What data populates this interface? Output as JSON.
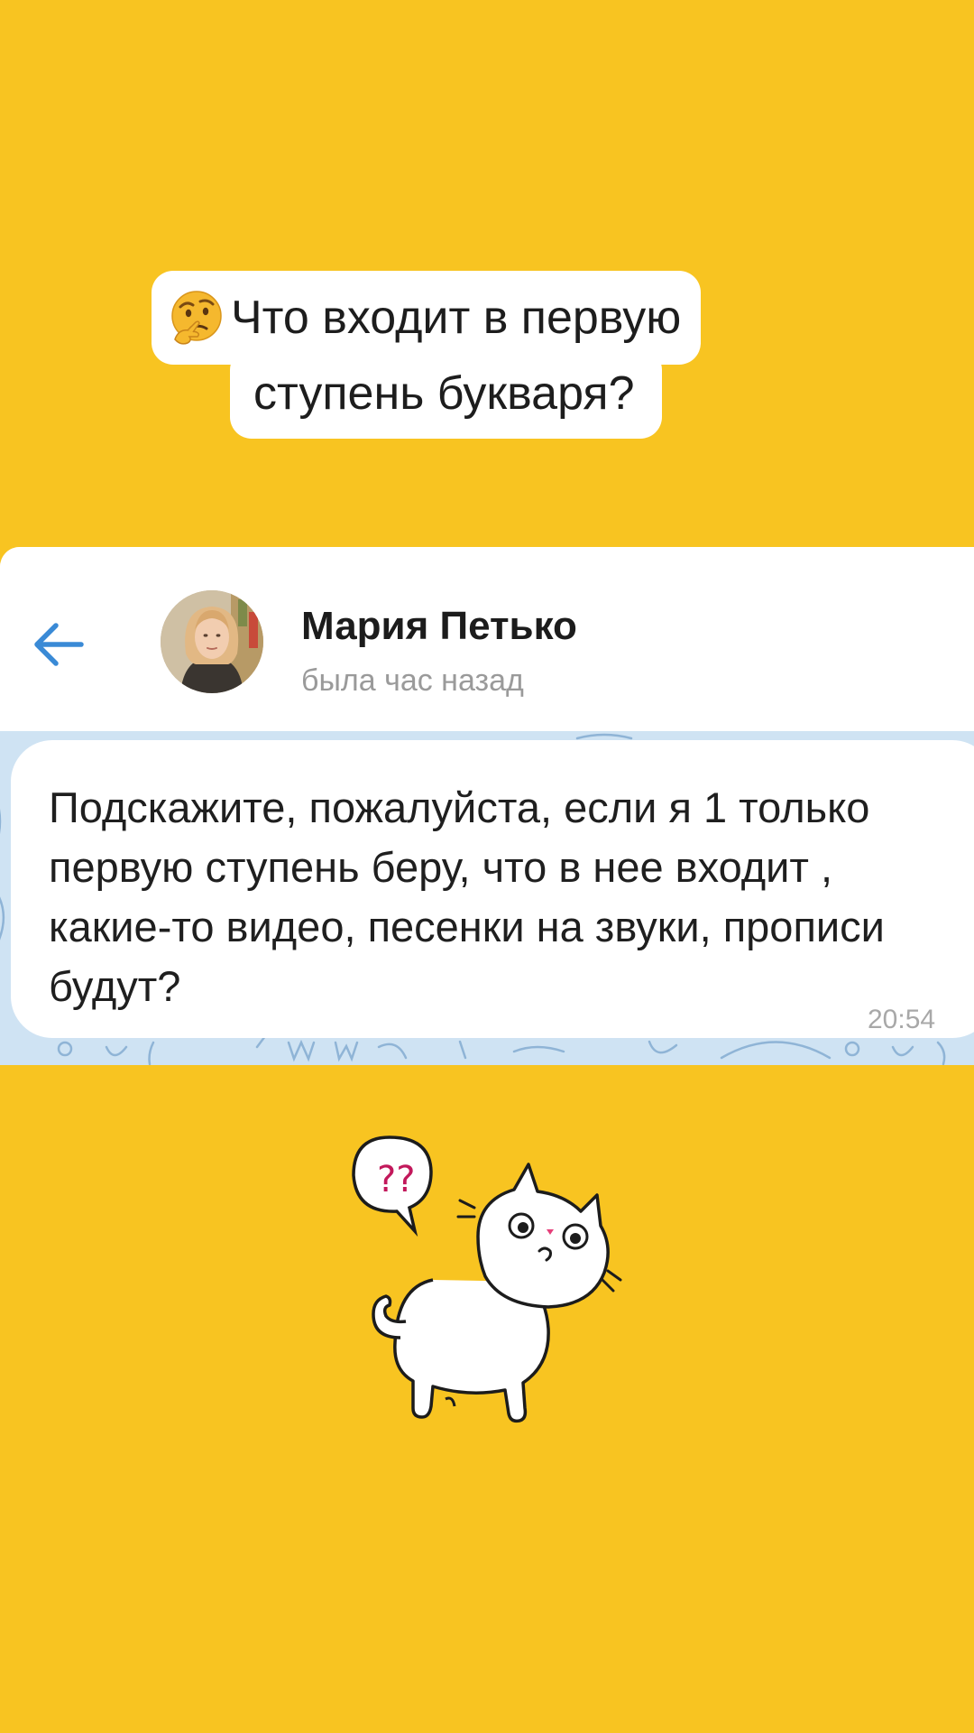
{
  "heading": {
    "line1": "Что входит в первую",
    "line2": "ступень букваря?",
    "emoji": "thinking-face-icon"
  },
  "chat": {
    "back_icon": "arrow-left-icon",
    "contact_name": "Мария Петько",
    "contact_status": "была час назад",
    "message": {
      "text": "Подскажите, пожалуйста, если я 1 только первую ступень беру, что в нее входит , какие-то видео, песенки на звуки, прописи будут?",
      "time": "20:54"
    }
  },
  "sticker": {
    "bubble_text": "??",
    "icon": "confused-cat-icon"
  },
  "colors": {
    "background": "#f8c421",
    "accent": "#3a8ad6",
    "chat_background": "#cfe3f3"
  }
}
